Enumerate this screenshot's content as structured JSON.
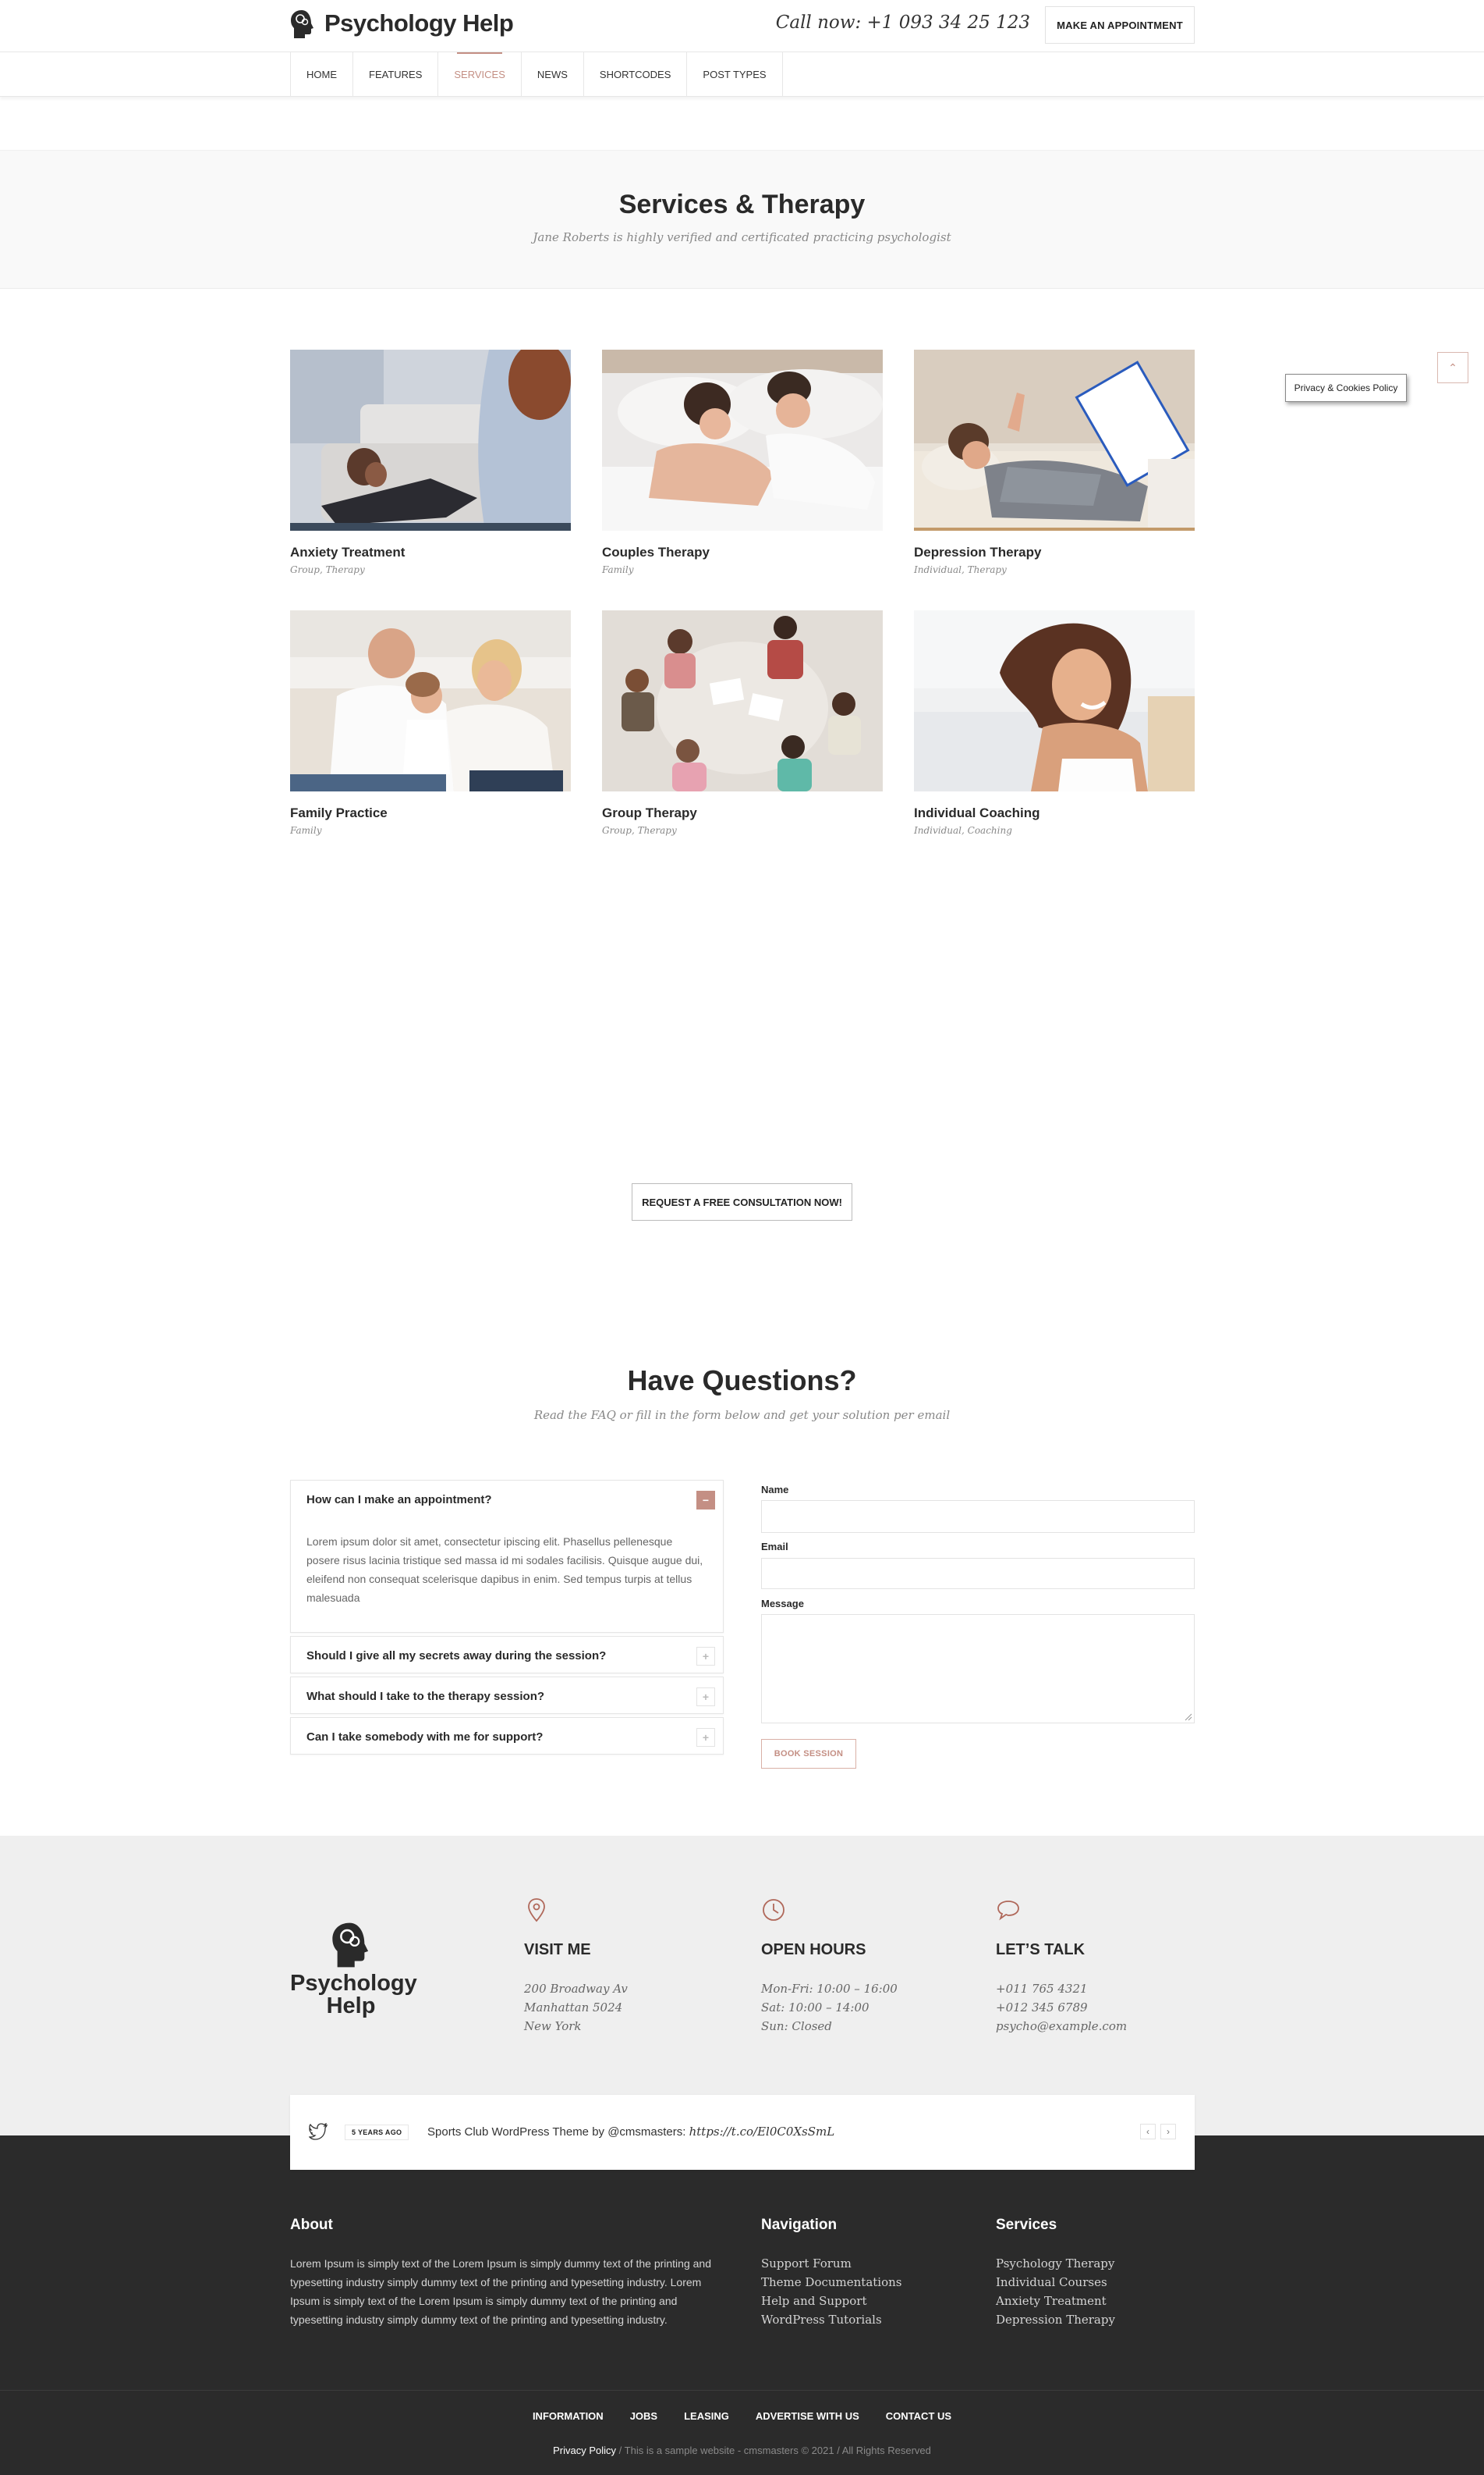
{
  "header": {
    "logo_text": "Psychology Help",
    "phone": "Call now: +1 093 34 25 123",
    "appointment_button": "MAKE AN APPOINTMENT"
  },
  "nav": {
    "items": [
      "HOME",
      "FEATURES",
      "SERVICES",
      "NEWS",
      "SHORTCODES",
      "POST TYPES"
    ],
    "active": "SERVICES"
  },
  "hero": {
    "title": "Services & Therapy",
    "subtitle": "Jane Roberts is highly verified and certificated practicing psychologist"
  },
  "services": [
    {
      "title": "Anxiety Treatment",
      "tags": "Group, Therapy",
      "image": "therapy-session-photo"
    },
    {
      "title": "Couples Therapy",
      "tags": "Family",
      "image": "couple-in-bed-photo"
    },
    {
      "title": "Depression Therapy",
      "tags": "Individual, Therapy",
      "image": "patient-on-couch-photo"
    },
    {
      "title": "Family Practice",
      "tags": "Family",
      "image": "family-photo"
    },
    {
      "title": "Group Therapy",
      "tags": "Group, Therapy",
      "image": "group-circle-photo"
    },
    {
      "title": "Individual Coaching",
      "tags": "Individual, Coaching",
      "image": "smiling-woman-photo"
    }
  ],
  "cookie_popup": "Privacy & Cookies Policy",
  "consult_button": "REQUEST A FREE CONSULTATION NOW!",
  "faq": {
    "title": "Have Questions?",
    "subtitle": "Read the FAQ or fill in the form below and get your solution per email",
    "items": [
      {
        "q": "How can I make an appointment?",
        "a": "Lorem ipsum dolor sit amet, consectetur ipiscing elit. Phasellus pellenesque posere risus lacinia tristique sed massa id mi sodales facilisis. Quisque augue dui, eleifend non consequat scelerisque dapibus in enim. Sed tempus turpis at tellus malesuada",
        "open": true
      },
      {
        "q": "Should I give all my secrets away during the session?",
        "open": false
      },
      {
        "q": "What should I take to the therapy session?",
        "open": false
      },
      {
        "q": "Can I take somebody with me for support?",
        "open": false
      }
    ],
    "toggle_open": "−",
    "toggle_closed": "+"
  },
  "form": {
    "name_label": "Name",
    "email_label": "Email",
    "message_label": "Message",
    "submit": "BOOK SESSION"
  },
  "info": {
    "logo_line1": "Psychology",
    "logo_line2": "Help",
    "visit": {
      "title": "VISIT ME",
      "lines": [
        "200 Broadway Av",
        "Manhattan 5024",
        "New York"
      ]
    },
    "hours": {
      "title": "OPEN HOURS",
      "lines": [
        "Mon-Fri: 10:00 – 16:00",
        "Sat: 10:00 – 14:00",
        "Sun: Closed"
      ]
    },
    "talk": {
      "title": "LET’S TALK",
      "lines": [
        "+011 765 4321",
        "+012 345 6789",
        "psycho@example.com"
      ]
    }
  },
  "tweet": {
    "time": "5 YEARS AGO",
    "text": "Sports Club WordPress Theme by @cmsmasters: ",
    "link": "https://t.co/El0C0XsSmL",
    "prev": "‹",
    "next": "›"
  },
  "footer": {
    "about_title": "About",
    "about_text": "Lorem Ipsum is simply text of the Lorem Ipsum is simply dummy text of the printing and typesetting industry simply dummy text of the printing and typesetting industry. Lorem Ipsum is simply text of the Lorem Ipsum is simply dummy text of the printing and typesetting industry simply dummy text of the printing and typesetting industry.",
    "nav_title": "Navigation",
    "nav_links": [
      "Support Forum",
      "Theme Documentations",
      "Help and Support",
      "WordPress Tutorials"
    ],
    "services_title": "Services",
    "services_links": [
      "Psychology Therapy",
      "Individual Courses",
      "Anxiety Treatment",
      "Depression Therapy"
    ],
    "bottom_nav": [
      "INFORMATION",
      "JOBS",
      "LEASING",
      "ADVERTISE WITH US",
      "CONTACT US"
    ],
    "privacy": "Privacy Policy",
    "copyright": " / This is a sample website - cmsmasters © 2021 / All Rights Reserved"
  },
  "colors": {
    "accent": "#c48f84",
    "dark": "#2b2b2b",
    "light_band": "#efefef"
  }
}
